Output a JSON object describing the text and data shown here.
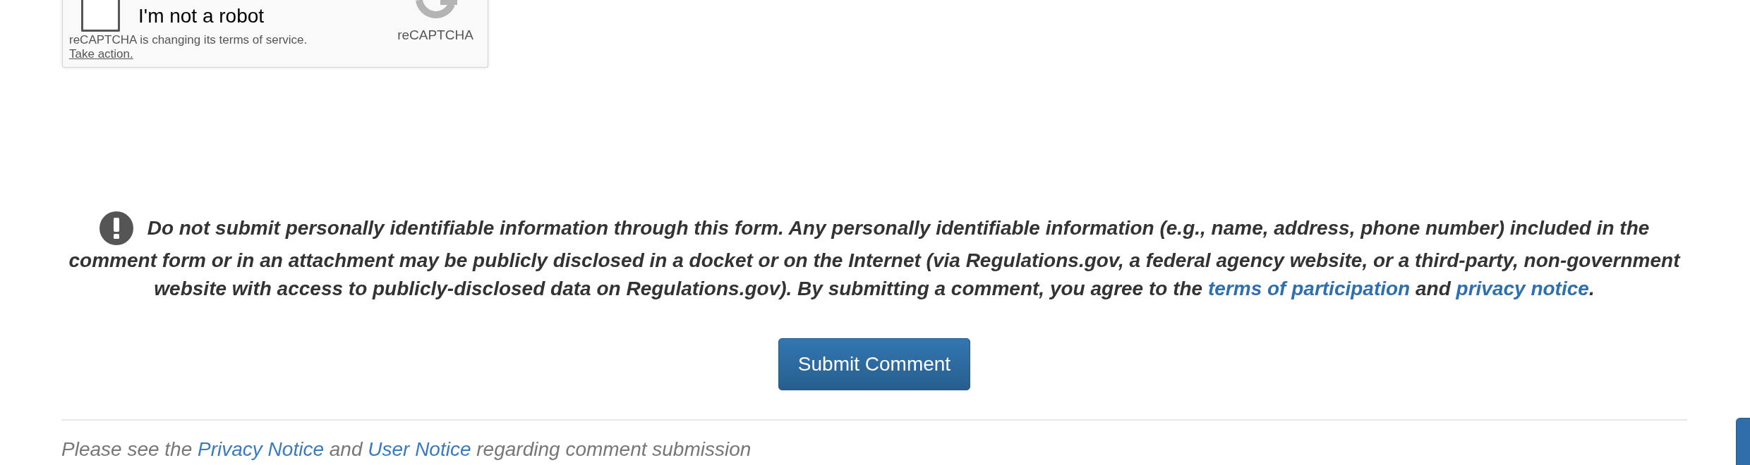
{
  "recaptcha": {
    "label": "I'm not a robot",
    "checked": false,
    "notice": "reCAPTCHA is changing its terms of service.",
    "notice_link": "Take action.",
    "brand": "reCAPTCHA"
  },
  "warning": {
    "segments": [
      {
        "kind": "text",
        "text": "Do not submit personally identifiable information through this form. Any personally identifiable information (e.g., name, address, phone number) included in the comment form or in an attachment may be publicly disclosed in a docket or on the Internet (via Regulations.gov, a federal agency website, or a third-party, non-government website with access to publicly-disclosed data on Regulations.gov). By submitting a comment, you agree to the "
      },
      {
        "kind": "link",
        "text": "terms of participation"
      },
      {
        "kind": "text",
        "text": " and "
      },
      {
        "kind": "link",
        "text": "privacy notice"
      },
      {
        "kind": "text",
        "text": "."
      }
    ]
  },
  "submit_button": {
    "label": "Submit Comment"
  },
  "footer_note": {
    "segments": [
      {
        "kind": "text",
        "text": "Please see the "
      },
      {
        "kind": "link",
        "text": "Privacy Notice"
      },
      {
        "kind": "text",
        "text": " and "
      },
      {
        "kind": "link",
        "text": "User Notice"
      },
      {
        "kind": "text",
        "text": " regarding comment submission"
      }
    ]
  }
}
